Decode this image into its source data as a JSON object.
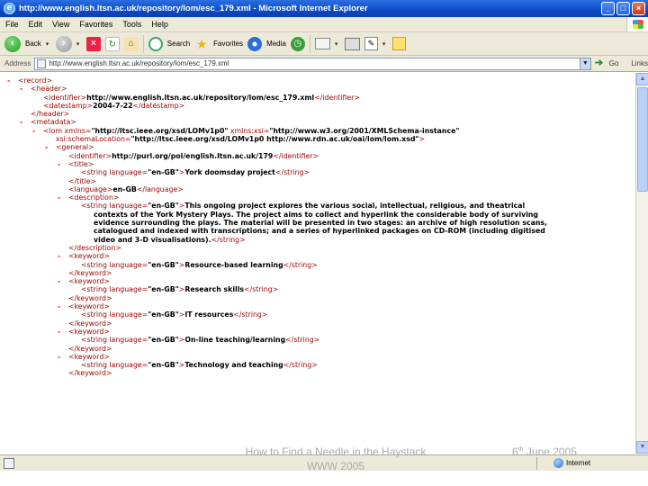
{
  "window": {
    "title": "http://www.english.ltsn.ac.uk/repository/lom/esc_179.xml - Microsoft Internet Explorer",
    "buttons": {
      "minimize": "_",
      "maximize": "□",
      "close": "×"
    }
  },
  "menu": [
    "File",
    "Edit",
    "View",
    "Favorites",
    "Tools",
    "Help"
  ],
  "toolbar": {
    "back": "Back",
    "search": "Search",
    "favorites": "Favorites",
    "media": "Media"
  },
  "address": {
    "label": "Address",
    "url": "http://www.english.ltsn.ac.uk/repository/lom/esc_179.xml",
    "go": "Go",
    "links": "Links"
  },
  "xml_lines": [
    {
      "indent": 0,
      "dash": true,
      "parts": [
        {
          "c": "tg",
          "t": "<record>"
        }
      ]
    },
    {
      "indent": 1,
      "dash": true,
      "parts": [
        {
          "c": "tg",
          "t": "<header>"
        }
      ]
    },
    {
      "indent": 2,
      "dash": false,
      "parts": [
        {
          "c": "tg",
          "t": "<identifier>"
        },
        {
          "c": "tx",
          "t": "http://www.english.ltsn.ac.uk/repository/lom/esc_179.xml"
        },
        {
          "c": "tg",
          "t": "</identifier>"
        }
      ]
    },
    {
      "indent": 2,
      "dash": false,
      "parts": [
        {
          "c": "tg",
          "t": "<datestamp>"
        },
        {
          "c": "tx",
          "t": "2004-7-22"
        },
        {
          "c": "tg",
          "t": "</datestamp>"
        }
      ]
    },
    {
      "indent": 1,
      "dash": false,
      "parts": [
        {
          "c": "tg",
          "t": "</header>"
        }
      ]
    },
    {
      "indent": 1,
      "dash": true,
      "parts": [
        {
          "c": "tg",
          "t": "<metadata>"
        }
      ]
    },
    {
      "indent": 2,
      "dash": true,
      "parts": [
        {
          "c": "tg",
          "t": "<lom xmlns="
        },
        {
          "c": "tx",
          "t": "\"http://ltsc.ieee.org/xsd/LOMv1p0\""
        },
        {
          "c": "tg",
          "t": " xmlns:xsi="
        },
        {
          "c": "tx",
          "t": "\"http://www.w3.org/2001/XMLSchema-instance\""
        }
      ]
    },
    {
      "indent": 3,
      "dash": false,
      "parts": [
        {
          "c": "tg",
          "t": "xsi:schemaLocation="
        },
        {
          "c": "tx",
          "t": "\"http://ltsc.ieee.org/xsd/LOMv1p0 http://www.rdn.ac.uk/oai/lom/lom.xsd\""
        },
        {
          "c": "tg",
          "t": ">"
        }
      ]
    },
    {
      "indent": 3,
      "dash": true,
      "parts": [
        {
          "c": "tg",
          "t": "<general>"
        }
      ]
    },
    {
      "indent": 4,
      "dash": false,
      "parts": [
        {
          "c": "tg",
          "t": "<identifier>"
        },
        {
          "c": "tx",
          "t": "http://purl.org/pol/english.ltsn.ac.uk/179"
        },
        {
          "c": "tg",
          "t": "</identifier>"
        }
      ]
    },
    {
      "indent": 4,
      "dash": true,
      "parts": [
        {
          "c": "tg",
          "t": "<title>"
        }
      ]
    },
    {
      "indent": 5,
      "dash": false,
      "parts": [
        {
          "c": "tg",
          "t": "<string language="
        },
        {
          "c": "tx",
          "t": "\"en-GB\""
        },
        {
          "c": "tg",
          "t": ">"
        },
        {
          "c": "tx",
          "t": "York doomsday project"
        },
        {
          "c": "tg",
          "t": "</string>"
        }
      ]
    },
    {
      "indent": 4,
      "dash": false,
      "parts": [
        {
          "c": "tg",
          "t": "</title>"
        }
      ]
    },
    {
      "indent": 4,
      "dash": false,
      "parts": [
        {
          "c": "tg",
          "t": "<language>"
        },
        {
          "c": "tx",
          "t": "en-GB"
        },
        {
          "c": "tg",
          "t": "</language>"
        }
      ]
    },
    {
      "indent": 4,
      "dash": true,
      "parts": [
        {
          "c": "tg",
          "t": "<description>"
        }
      ]
    },
    {
      "indent": 5,
      "dash": false,
      "parts": [
        {
          "c": "tg",
          "t": "<string language="
        },
        {
          "c": "tx",
          "t": "\"en-GB\""
        },
        {
          "c": "tg",
          "t": ">"
        },
        {
          "c": "tx",
          "t": "This ongoing project explores the various social, intellectual, religious, and theatrical"
        }
      ]
    },
    {
      "indent": 6,
      "dash": false,
      "parts": [
        {
          "c": "tx",
          "t": "contexts of the York Mystery Plays. The project aims to collect and hyperlink the considerable body of surviving"
        }
      ]
    },
    {
      "indent": 6,
      "dash": false,
      "parts": [
        {
          "c": "tx",
          "t": "evidence surrounding the plays. The material will be presented in two stages: an archive of high resolution scans,"
        }
      ]
    },
    {
      "indent": 6,
      "dash": false,
      "parts": [
        {
          "c": "tx",
          "t": "catalogued and indexed with transcriptions; and a series of hyperlinked packages on CD-ROM (including digitised"
        }
      ]
    },
    {
      "indent": 6,
      "dash": false,
      "parts": [
        {
          "c": "tx",
          "t": "video and 3-D visualisations)."
        },
        {
          "c": "tg",
          "t": "</string>"
        }
      ]
    },
    {
      "indent": 4,
      "dash": false,
      "parts": [
        {
          "c": "tg",
          "t": "</description>"
        }
      ]
    },
    {
      "indent": 4,
      "dash": true,
      "parts": [
        {
          "c": "tg",
          "t": "<keyword>"
        }
      ]
    },
    {
      "indent": 5,
      "dash": false,
      "parts": [
        {
          "c": "tg",
          "t": "<string language="
        },
        {
          "c": "tx",
          "t": "\"en-GB\""
        },
        {
          "c": "tg",
          "t": ">"
        },
        {
          "c": "tx",
          "t": "Resource-based learning"
        },
        {
          "c": "tg",
          "t": "</string>"
        }
      ]
    },
    {
      "indent": 4,
      "dash": false,
      "parts": [
        {
          "c": "tg",
          "t": "</keyword>"
        }
      ]
    },
    {
      "indent": 4,
      "dash": true,
      "parts": [
        {
          "c": "tg",
          "t": "<keyword>"
        }
      ]
    },
    {
      "indent": 5,
      "dash": false,
      "parts": [
        {
          "c": "tg",
          "t": "<string language="
        },
        {
          "c": "tx",
          "t": "\"en-GB\""
        },
        {
          "c": "tg",
          "t": ">"
        },
        {
          "c": "tx",
          "t": "Research skills"
        },
        {
          "c": "tg",
          "t": "</string>"
        }
      ]
    },
    {
      "indent": 4,
      "dash": false,
      "parts": [
        {
          "c": "tg",
          "t": "</keyword>"
        }
      ]
    },
    {
      "indent": 4,
      "dash": true,
      "parts": [
        {
          "c": "tg",
          "t": "<keyword>"
        }
      ]
    },
    {
      "indent": 5,
      "dash": false,
      "parts": [
        {
          "c": "tg",
          "t": "<string language="
        },
        {
          "c": "tx",
          "t": "\"en-GB\""
        },
        {
          "c": "tg",
          "t": ">"
        },
        {
          "c": "tx",
          "t": "IT resources"
        },
        {
          "c": "tg",
          "t": "</string>"
        }
      ]
    },
    {
      "indent": 4,
      "dash": false,
      "parts": [
        {
          "c": "tg",
          "t": "</keyword>"
        }
      ]
    },
    {
      "indent": 4,
      "dash": true,
      "parts": [
        {
          "c": "tg",
          "t": "<keyword>"
        }
      ]
    },
    {
      "indent": 5,
      "dash": false,
      "parts": [
        {
          "c": "tg",
          "t": "<string language="
        },
        {
          "c": "tx",
          "t": "\"en-GB\""
        },
        {
          "c": "tg",
          "t": ">"
        },
        {
          "c": "tx",
          "t": "On-line teaching/learning"
        },
        {
          "c": "tg",
          "t": "</string>"
        }
      ]
    },
    {
      "indent": 4,
      "dash": false,
      "parts": [
        {
          "c": "tg",
          "t": "</keyword>"
        }
      ]
    },
    {
      "indent": 4,
      "dash": true,
      "parts": [
        {
          "c": "tg",
          "t": "<keyword>"
        }
      ]
    },
    {
      "indent": 5,
      "dash": false,
      "parts": [
        {
          "c": "tg",
          "t": "<string language="
        },
        {
          "c": "tx",
          "t": "\"en-GB\""
        },
        {
          "c": "tg",
          "t": ">"
        },
        {
          "c": "tx",
          "t": "Technology and teaching"
        },
        {
          "c": "tg",
          "t": "</string>"
        }
      ]
    },
    {
      "indent": 4,
      "dash": false,
      "parts": [
        {
          "c": "tg",
          "t": "</keyword>"
        }
      ]
    }
  ],
  "status": {
    "zone": "Internet"
  },
  "footer": {
    "title_line1": "How to Find a Needle in the Haystack",
    "title_line2": "WWW 2005",
    "date_day": "6",
    "date_suffix": "th",
    "date_rest": " June 2005"
  },
  "colors": {
    "tag": "#990000",
    "collapse_dash": "#ff0000",
    "titlebar": "#0a4bc4"
  }
}
